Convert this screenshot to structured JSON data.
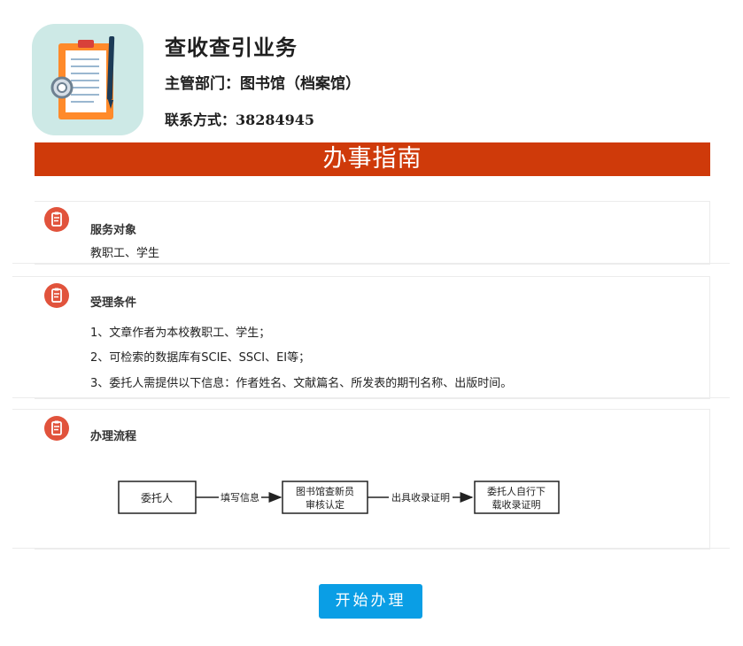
{
  "header": {
    "title": "查收查引业务",
    "department": "主管部门：图书馆（档案馆）",
    "contact": "联系方式：38284945",
    "icon": "clipboard-document-icon"
  },
  "banner": {
    "label": "办事指南"
  },
  "sections": [
    {
      "title": "服务对象",
      "icon": "document-list-icon",
      "lines": [
        "教职工、学生"
      ]
    },
    {
      "title": "受理条件",
      "icon": "document-list-icon",
      "lines": [
        "1、文章作者为本校教职工、学生；",
        "2、可检索的数据库有SCIE、SSCI、EI等；",
        "3、委托人需提供以下信息：作者姓名、文献篇名、所发表的期刊名称、出版时间。"
      ]
    },
    {
      "title": "办理流程",
      "icon": "document-list-icon",
      "flow": {
        "steps": [
          "委托人",
          "图书馆查新员",
          "审核认定",
          "委托人自行下",
          "载收录证明"
        ],
        "arrows": [
          "填写信息",
          "出具收录证明"
        ]
      }
    }
  ],
  "actions": {
    "start_label": "开始办理"
  },
  "colors": {
    "banner": "#cf3a0a",
    "section_icon": "#e1533c",
    "button": "#0a9ee5",
    "app_icon_bg": "#cde9e6"
  }
}
